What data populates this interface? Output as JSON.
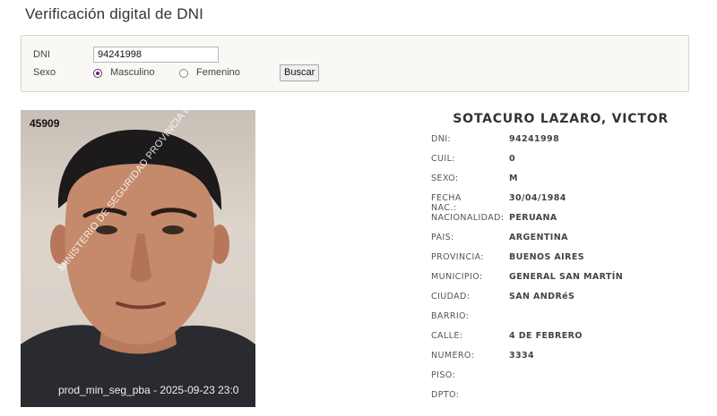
{
  "header": {
    "title": "Verificación digital de DNI"
  },
  "search": {
    "dni_label": "DNI",
    "dni_value": "94241998",
    "sexo_label": "Sexo",
    "option_masculino": "Masculino",
    "option_femenino": "Femenino",
    "selected": "Masculino",
    "submit_label": "Buscar"
  },
  "photo": {
    "id_number": "45909",
    "watermark": "MINISTERIO DE SEGURIDAD PROVINCIA DE B",
    "stamp": "prod_min_seg_pba - 2025-09-23 23:0"
  },
  "person": {
    "full_name": "SOTACURO LAZARO, VICTOR",
    "fields": [
      {
        "key": "DNI:",
        "value": "94241998"
      },
      {
        "key": "CUIL:",
        "value": "0"
      },
      {
        "key": "SEXO:",
        "value": "M"
      },
      {
        "key": "FECHA NAC.:",
        "value": "30/04/1984"
      },
      {
        "key": "NACIONALIDAD:",
        "value": "PERUANA"
      },
      {
        "key": "PAIS:",
        "value": "ARGENTINA"
      },
      {
        "key": "PROVINCIA:",
        "value": "BUENOS AIRES"
      },
      {
        "key": "MUNICIPIO:",
        "value": "GENERAL SAN MARTÍN"
      },
      {
        "key": "CIUDAD:",
        "value": "SAN ANDRéS"
      },
      {
        "key": "BARRIO:",
        "value": ""
      },
      {
        "key": "CALLE:",
        "value": "4 DE FEBRERO"
      },
      {
        "key": "NUMERO:",
        "value": "3334"
      },
      {
        "key": "PISO:",
        "value": ""
      },
      {
        "key": "DPTO:",
        "value": ""
      }
    ]
  },
  "colors": {
    "radio_accent": "#6c2a78",
    "panel_bg": "#f9f8f5",
    "panel_border": "#d9d4cc"
  }
}
